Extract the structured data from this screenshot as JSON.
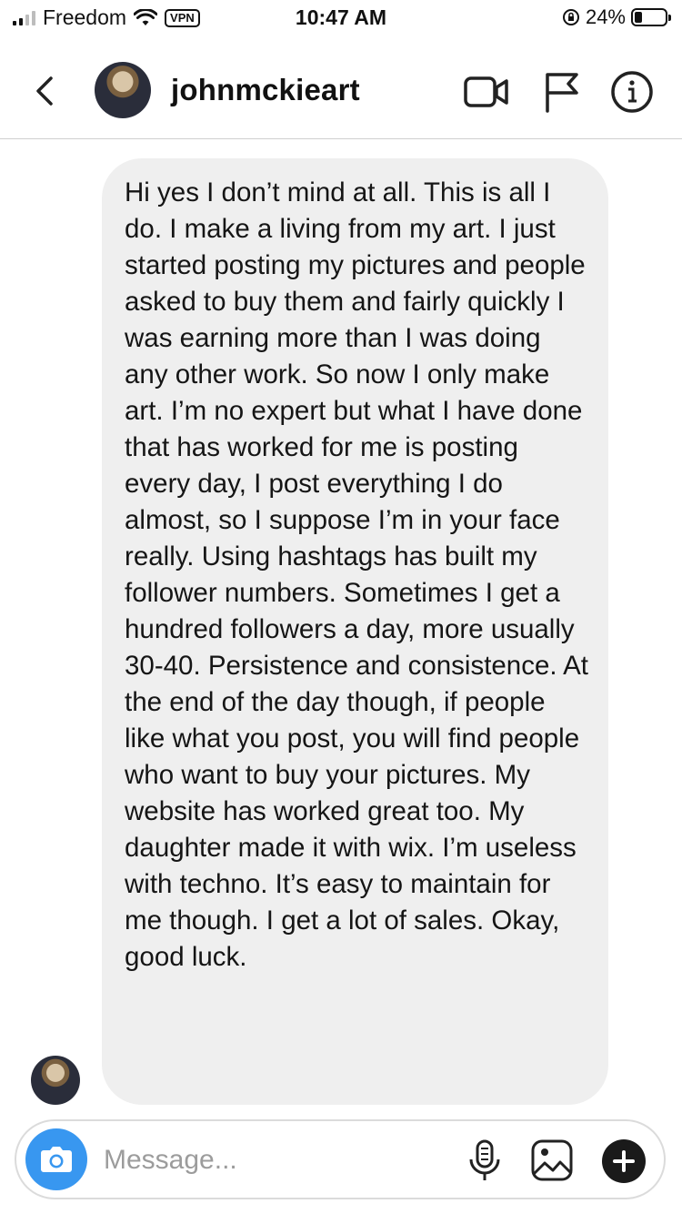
{
  "status_bar": {
    "carrier": "Freedom",
    "vpn_label": "VPN",
    "time": "10:47 AM",
    "battery_text": "24%",
    "battery_level": 0.24
  },
  "header": {
    "username": "johnmckieart",
    "icons": [
      "back-chevron",
      "video-camera",
      "flag",
      "info"
    ]
  },
  "conversation": {
    "message": "Hi yes I don’t mind at all. This is all I do. I make a living from my art. I just started posting my pictures and people asked to buy them and fairly quickly I was earning more than I was doing any other work. So now I only make art. I’m no expert but what I have done that has worked for me is posting every day, I post everything I do almost, so I suppose I’m in your face really. Using hashtags has built my follower numbers. Sometimes I get a hundred followers a day, more usually 30-40. Persistence and consistence. At the end of the day though, if people like what you post, you will find people who want to buy your pictures. My website has worked great too. My daughter made it with wix. I’m useless with techno. It’s easy to maintain for me though. I get a lot of sales. Okay, good luck."
  },
  "composer": {
    "placeholder": "Message...",
    "icons": [
      "camera",
      "microphone",
      "gallery",
      "plus"
    ]
  },
  "colors": {
    "accent_blue": "#3897f0",
    "bubble_gray": "#efefef",
    "border_gray": "#dbdbdb"
  }
}
